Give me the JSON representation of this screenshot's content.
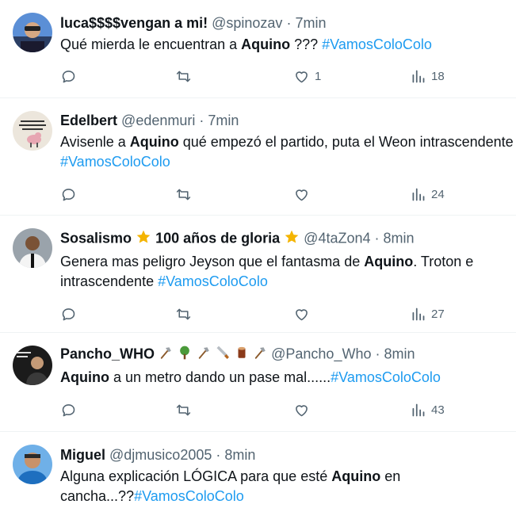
{
  "tweets": [
    {
      "name": "luca$$$$vengan a mi!",
      "handle": "@spinozav",
      "dot": "·",
      "time": "7min",
      "text_a": "Qué mierda le encuentran a ",
      "text_b": "Aquino",
      "text_c": " ???  ",
      "hashtag": "#VamosColoColo",
      "likes": "1",
      "views": "18"
    },
    {
      "name": "Edelbert",
      "handle": "@edenmuri",
      "dot": "·",
      "time": "7min",
      "text_a": "Avisenle a ",
      "text_b": "Aquino",
      "text_c": " qué empezó el partido, puta el Weon intrascendente",
      "hashtag": "#VamosColoColo",
      "views": "24"
    },
    {
      "name": "Sosalismo",
      "name_tail": "100 años de gloria",
      "handle": "@4taZon4",
      "dot": "·",
      "time": "8min",
      "line1_a": "Genera mas peligro Jeyson que el fantasma de ",
      "line1_b": "Aquino",
      "line1_c": ". Troton e",
      "line2_a": "intrascendente  ",
      "hashtag": "#VamosColoColo",
      "views": "27"
    },
    {
      "name": "Pancho_WHO",
      "handle": "@Pancho_Who",
      "dot": "·",
      "time": "8min",
      "text_b": "Aquino",
      "text_c": " a un metro dando un pase mal......",
      "hashtag": "#VamosColoColo",
      "views": "43"
    },
    {
      "name": "Miguel",
      "handle": "@djmusico2005",
      "dot": "·",
      "time": "8min",
      "line1_a": "Alguna explicación LÓGICA para que esté ",
      "line1_b": "Aquino",
      "line1_c": " en",
      "line2_a": "cancha...??",
      "hashtag": "#VamosColoColo"
    }
  ],
  "colors": {
    "accent": "#1d9bf0",
    "muted": "#536471",
    "text": "#0f1419"
  },
  "icons": [
    "reply-icon",
    "retweet-icon",
    "like-icon",
    "views-icon",
    "star-icon",
    "axe-icon",
    "tree-icon",
    "saw-icon",
    "log-icon"
  ]
}
